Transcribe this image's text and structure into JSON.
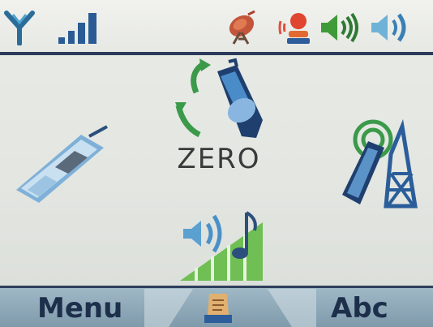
{
  "status_bar": {
    "icons": [
      "antenna-icon",
      "signal-strength-icon",
      "satellite-dish-icon",
      "caller-icon",
      "speaker-volume-icon",
      "speaker-icon"
    ]
  },
  "main": {
    "center_label": "ZERO",
    "icons": [
      "phone-sync-icon",
      "mobile-phone-icon",
      "phone-tower-signal-icon",
      "ringtone-volume-icon"
    ]
  },
  "softkeys": {
    "left_label": "Menu",
    "center_icon": "contacts-card-icon",
    "right_label": "Abc"
  }
}
